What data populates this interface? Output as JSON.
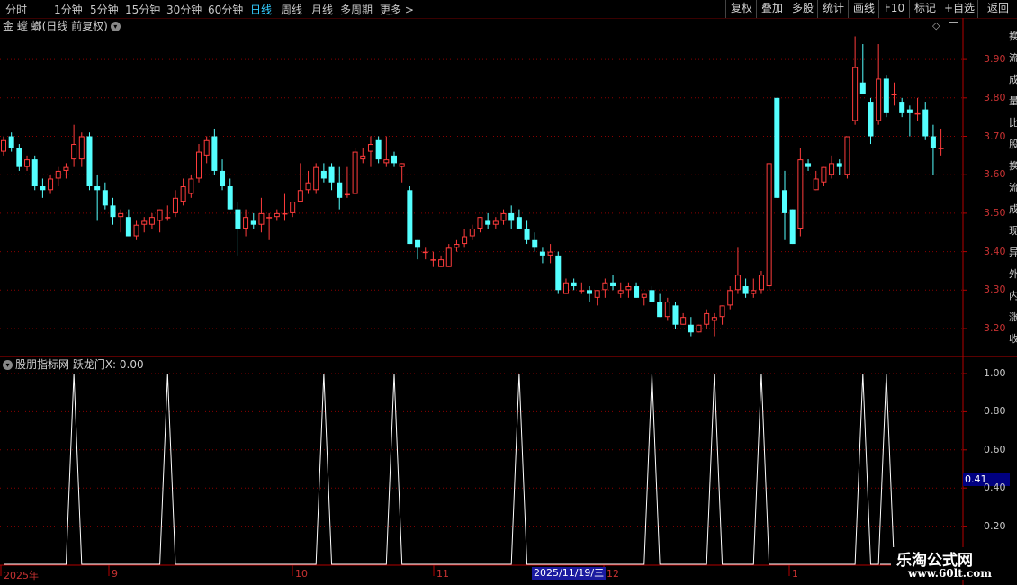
{
  "toolbar": {
    "periods": [
      {
        "label": "分时",
        "active": false
      },
      {
        "label": "1分钟",
        "active": false
      },
      {
        "label": "5分钟",
        "active": false
      },
      {
        "label": "15分钟",
        "active": false
      },
      {
        "label": "30分钟",
        "active": false
      },
      {
        "label": "60分钟",
        "active": false
      },
      {
        "label": "日线",
        "active": true
      },
      {
        "label": "周线",
        "active": false
      },
      {
        "label": "月线",
        "active": false
      },
      {
        "label": "多周期",
        "active": false
      },
      {
        "label": "更多 >",
        "active": false
      }
    ],
    "right_buttons": [
      "复权",
      "叠加",
      "多股",
      "统计",
      "画线",
      "F10",
      "标记",
      "+自选",
      "返回"
    ]
  },
  "main_chart": {
    "title": "金 螳 螂(日线 前复权)",
    "y_axis": [
      "3.90",
      "3.80",
      "3.70",
      "3.60",
      "3.50",
      "3.40",
      "3.30",
      "3.20"
    ]
  },
  "indicator": {
    "label": "股朋指标网 跃龙门X: 0.00",
    "y_axis": [
      "1.00",
      "0.80",
      "0.60",
      "0.40",
      "0.20"
    ],
    "current_value_tag": "0.41"
  },
  "time_axis": {
    "labels": [
      {
        "text": "2025年"
      },
      {
        "text": "9"
      },
      {
        "text": "10"
      },
      {
        "text": "11"
      },
      {
        "text": "12"
      },
      {
        "text": "1"
      }
    ],
    "cursor_date": "2025/11/19/三"
  },
  "side_panel_chars": [
    "换",
    "流",
    "成",
    "量",
    "比",
    "股",
    "换",
    "流",
    "成",
    "现",
    "异",
    "外",
    "内",
    "涨",
    "收"
  ],
  "watermark": {
    "title": "乐淘公式网",
    "url": "www.60lt.com"
  },
  "colors": {
    "up": "#ff3c3c",
    "down": "#54ffff",
    "grid": "#8a0000",
    "active_tab": "#33ccff"
  },
  "chart_data": {
    "type": "candlestick",
    "ylim": [
      3.15,
      3.97
    ],
    "ohlc": [
      [
        3.66,
        3.7,
        3.65,
        3.69
      ],
      [
        3.7,
        3.71,
        3.66,
        3.67
      ],
      [
        3.67,
        3.68,
        3.61,
        3.62
      ],
      [
        3.62,
        3.65,
        3.61,
        3.64
      ],
      [
        3.64,
        3.65,
        3.56,
        3.57
      ],
      [
        3.57,
        3.59,
        3.54,
        3.56
      ],
      [
        3.56,
        3.6,
        3.55,
        3.59
      ],
      [
        3.59,
        3.62,
        3.57,
        3.61
      ],
      [
        3.61,
        3.63,
        3.59,
        3.62
      ],
      [
        3.64,
        3.73,
        3.62,
        3.68
      ],
      [
        3.64,
        3.71,
        3.62,
        3.7
      ],
      [
        3.7,
        3.71,
        3.56,
        3.57
      ],
      [
        3.57,
        3.6,
        3.48,
        3.56
      ],
      [
        3.56,
        3.58,
        3.51,
        3.52
      ],
      [
        3.52,
        3.54,
        3.47,
        3.49
      ],
      [
        3.49,
        3.51,
        3.45,
        3.5
      ],
      [
        3.49,
        3.51,
        3.44,
        3.44
      ],
      [
        3.44,
        3.48,
        3.43,
        3.47
      ],
      [
        3.47,
        3.49,
        3.45,
        3.48
      ],
      [
        3.47,
        3.5,
        3.46,
        3.49
      ],
      [
        3.48,
        3.51,
        3.45,
        3.51
      ],
      [
        3.49,
        3.52,
        3.48,
        3.49
      ],
      [
        3.5,
        3.56,
        3.49,
        3.54
      ],
      [
        3.53,
        3.59,
        3.52,
        3.57
      ],
      [
        3.55,
        3.6,
        3.54,
        3.59
      ],
      [
        3.59,
        3.68,
        3.58,
        3.66
      ],
      [
        3.65,
        3.7,
        3.63,
        3.69
      ],
      [
        3.7,
        3.72,
        3.6,
        3.61
      ],
      [
        3.61,
        3.64,
        3.56,
        3.57
      ],
      [
        3.57,
        3.59,
        3.51,
        3.51
      ],
      [
        3.51,
        3.53,
        3.39,
        3.46
      ],
      [
        3.46,
        3.51,
        3.44,
        3.49
      ],
      [
        3.48,
        3.5,
        3.46,
        3.47
      ],
      [
        3.47,
        3.54,
        3.45,
        3.5
      ],
      [
        3.49,
        3.5,
        3.43,
        3.49
      ],
      [
        3.49,
        3.51,
        3.48,
        3.5
      ],
      [
        3.5,
        3.55,
        3.48,
        3.5
      ],
      [
        3.5,
        3.53,
        3.49,
        3.53
      ],
      [
        3.53,
        3.63,
        3.53,
        3.56
      ],
      [
        3.56,
        3.61,
        3.55,
        3.58
      ],
      [
        3.56,
        3.63,
        3.55,
        3.62
      ],
      [
        3.61,
        3.63,
        3.58,
        3.59
      ],
      [
        3.62,
        3.63,
        3.56,
        3.58
      ],
      [
        3.58,
        3.62,
        3.51,
        3.54
      ],
      [
        3.55,
        3.62,
        3.54,
        3.55
      ],
      [
        3.55,
        3.67,
        3.55,
        3.66
      ],
      [
        3.64,
        3.67,
        3.63,
        3.65
      ],
      [
        3.66,
        3.7,
        3.62,
        3.68
      ],
      [
        3.69,
        3.7,
        3.63,
        3.64
      ],
      [
        3.63,
        3.7,
        3.62,
        3.64
      ],
      [
        3.65,
        3.66,
        3.62,
        3.63
      ],
      [
        3.62,
        3.63,
        3.58,
        3.63
      ],
      [
        3.56,
        3.57,
        3.42,
        3.42
      ],
      [
        3.43,
        3.43,
        3.38,
        3.41
      ],
      [
        3.4,
        3.41,
        3.38,
        3.4
      ],
      [
        3.38,
        3.4,
        3.36,
        3.38
      ],
      [
        3.36,
        3.39,
        3.36,
        3.38
      ],
      [
        3.36,
        3.42,
        3.36,
        3.41
      ],
      [
        3.41,
        3.43,
        3.4,
        3.42
      ],
      [
        3.42,
        3.46,
        3.41,
        3.44
      ],
      [
        3.44,
        3.47,
        3.43,
        3.46
      ],
      [
        3.46,
        3.49,
        3.45,
        3.49
      ],
      [
        3.48,
        3.5,
        3.46,
        3.47
      ],
      [
        3.47,
        3.49,
        3.46,
        3.48
      ],
      [
        3.48,
        3.51,
        3.47,
        3.5
      ],
      [
        3.5,
        3.52,
        3.46,
        3.48
      ],
      [
        3.49,
        3.51,
        3.47,
        3.46
      ],
      [
        3.46,
        3.48,
        3.42,
        3.43
      ],
      [
        3.43,
        3.45,
        3.4,
        3.41
      ],
      [
        3.4,
        3.41,
        3.37,
        3.39
      ],
      [
        3.39,
        3.42,
        3.37,
        3.4
      ],
      [
        3.39,
        3.4,
        3.29,
        3.3
      ],
      [
        3.29,
        3.33,
        3.29,
        3.32
      ],
      [
        3.32,
        3.33,
        3.3,
        3.31
      ],
      [
        3.3,
        3.32,
        3.29,
        3.3
      ],
      [
        3.3,
        3.31,
        3.27,
        3.29
      ],
      [
        3.28,
        3.3,
        3.26,
        3.3
      ],
      [
        3.3,
        3.33,
        3.28,
        3.32
      ],
      [
        3.32,
        3.34,
        3.3,
        3.31
      ],
      [
        3.29,
        3.32,
        3.28,
        3.3
      ],
      [
        3.3,
        3.32,
        3.28,
        3.31
      ],
      [
        3.31,
        3.32,
        3.28,
        3.28
      ],
      [
        3.28,
        3.29,
        3.26,
        3.29
      ],
      [
        3.3,
        3.31,
        3.27,
        3.27
      ],
      [
        3.27,
        3.29,
        3.23,
        3.23
      ],
      [
        3.23,
        3.28,
        3.22,
        3.27
      ],
      [
        3.26,
        3.27,
        3.2,
        3.21
      ],
      [
        3.21,
        3.24,
        3.21,
        3.23
      ],
      [
        3.21,
        3.23,
        3.18,
        3.19
      ],
      [
        3.19,
        3.21,
        3.19,
        3.21
      ],
      [
        3.21,
        3.25,
        3.2,
        3.24
      ],
      [
        3.22,
        3.24,
        3.18,
        3.23
      ],
      [
        3.23,
        3.26,
        3.21,
        3.26
      ],
      [
        3.26,
        3.31,
        3.25,
        3.3
      ],
      [
        3.3,
        3.41,
        3.29,
        3.34
      ],
      [
        3.31,
        3.33,
        3.28,
        3.29
      ],
      [
        3.29,
        3.33,
        3.28,
        3.3
      ],
      [
        3.3,
        3.35,
        3.29,
        3.34
      ],
      [
        3.31,
        3.63,
        3.3,
        3.63
      ],
      [
        3.8,
        3.8,
        3.54,
        3.54
      ],
      [
        3.56,
        3.61,
        3.43,
        3.5
      ],
      [
        3.51,
        3.51,
        3.42,
        3.42
      ],
      [
        3.46,
        3.67,
        3.44,
        3.64
      ],
      [
        3.63,
        3.64,
        3.61,
        3.62
      ],
      [
        3.56,
        3.61,
        3.56,
        3.59
      ],
      [
        3.58,
        3.62,
        3.57,
        3.62
      ],
      [
        3.6,
        3.65,
        3.59,
        3.63
      ],
      [
        3.63,
        3.64,
        3.6,
        3.62
      ],
      [
        3.6,
        3.7,
        3.59,
        3.7
      ],
      [
        3.74,
        3.96,
        3.73,
        3.88
      ],
      [
        3.84,
        3.94,
        3.81,
        3.81
      ],
      [
        3.79,
        3.8,
        3.68,
        3.7
      ],
      [
        3.74,
        3.94,
        3.73,
        3.85
      ],
      [
        3.85,
        3.86,
        3.75,
        3.76
      ],
      [
        3.81,
        3.84,
        3.78,
        3.81
      ],
      [
        3.79,
        3.8,
        3.75,
        3.76
      ],
      [
        3.77,
        3.78,
        3.7,
        3.76
      ],
      [
        3.76,
        3.8,
        3.74,
        3.76
      ],
      [
        3.77,
        3.79,
        3.69,
        3.7
      ],
      [
        3.7,
        3.73,
        3.6,
        3.67
      ],
      [
        3.67,
        3.72,
        3.65,
        3.67
      ]
    ],
    "indicator_y_range": [
      0,
      1.05
    ],
    "indicator_spikes": [
      9,
      21,
      41,
      50,
      66,
      83,
      91,
      97,
      110,
      113
    ]
  }
}
